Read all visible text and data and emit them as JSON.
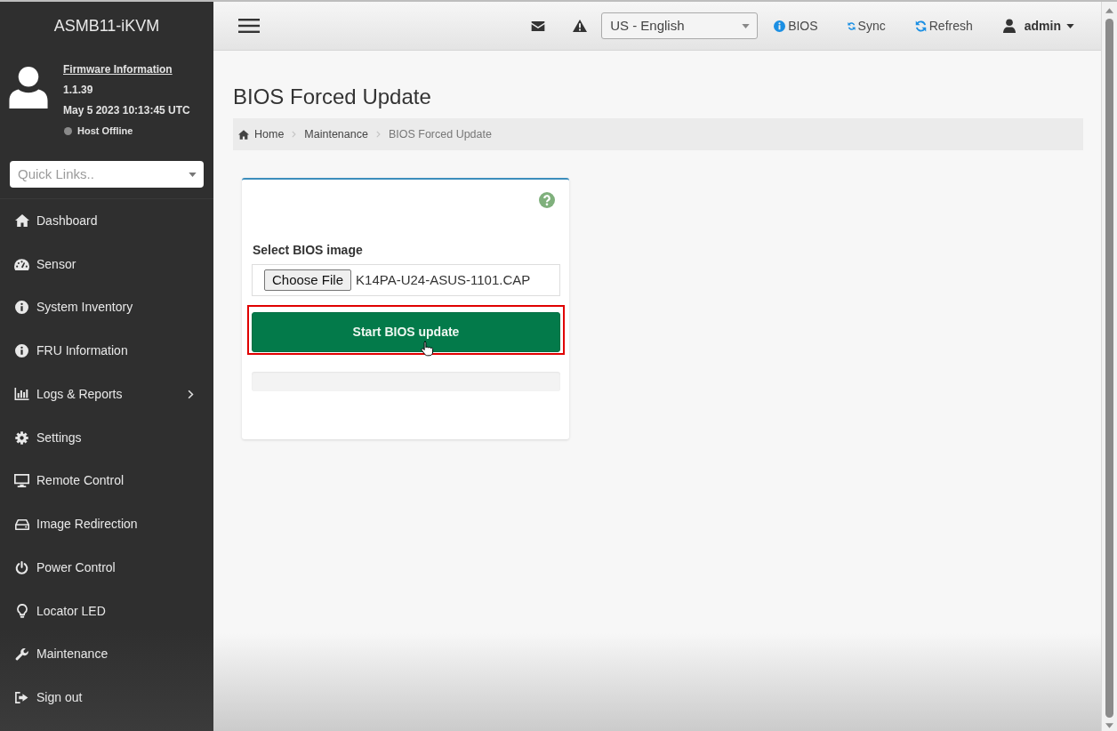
{
  "sidebar": {
    "title": "ASMB11-iKVM",
    "firmware": {
      "link": "Firmware Information",
      "version": "1.1.39",
      "build_date": "May 5 2023 10:13:45 UTC",
      "host_status": "Host Offline",
      "host_online": false
    },
    "quick_links": {
      "placeholder": "Quick Links.."
    },
    "items": [
      {
        "label": "Dashboard",
        "selected": false,
        "has_submenu": false
      },
      {
        "label": "Sensor",
        "selected": false,
        "has_submenu": false
      },
      {
        "label": "System Inventory",
        "selected": false,
        "has_submenu": false
      },
      {
        "label": "FRU Information",
        "selected": false,
        "has_submenu": false
      },
      {
        "label": "Logs & Reports",
        "selected": false,
        "has_submenu": true
      },
      {
        "label": "Settings",
        "selected": false,
        "has_submenu": false
      },
      {
        "label": "Remote Control",
        "selected": false,
        "has_submenu": false
      },
      {
        "label": "Image Redirection",
        "selected": false,
        "has_submenu": false
      },
      {
        "label": "Power Control",
        "selected": false,
        "has_submenu": false
      },
      {
        "label": "Locator LED",
        "selected": false,
        "has_submenu": false
      },
      {
        "label": "Maintenance",
        "selected": false,
        "has_submenu": false
      },
      {
        "label": "Sign out",
        "selected": false,
        "has_submenu": false
      }
    ]
  },
  "topbar": {
    "language": {
      "value": "US - English"
    },
    "links": [
      {
        "label": "BIOS"
      },
      {
        "label": "Sync"
      },
      {
        "label": "Refresh"
      }
    ],
    "user": {
      "name": "admin"
    }
  },
  "page": {
    "title": "BIOS Forced Update",
    "breadcrumb": [
      {
        "label": "Home",
        "current": false
      },
      {
        "label": "Maintenance",
        "current": false
      },
      {
        "label": "BIOS Forced Update",
        "current": true
      }
    ],
    "form": {
      "field_label": "Select BIOS image",
      "file_button": "Choose File",
      "file_name": "K14PA-U24-ASUS-1101.CAP",
      "submit": {
        "label": "Start BIOS update",
        "highlighted": true
      },
      "progress": {
        "level": 0
      }
    }
  }
}
